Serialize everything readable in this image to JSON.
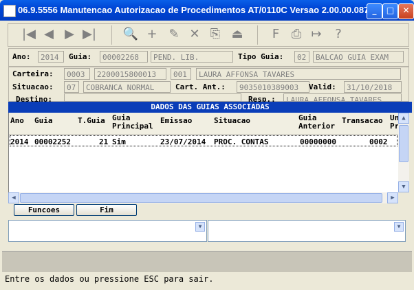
{
  "window": {
    "title": "06.9.5556 Manutencao Autorizacao de Procedimentos AT/0110C Versao 2.00.00.087...",
    "min": "_",
    "max": "□",
    "close": "✕"
  },
  "toolbar": {
    "first": "|◀",
    "prev": "◀",
    "next": "▶",
    "last": "▶|",
    "search": "🔍",
    "add": "+",
    "edit": "✎",
    "delete": "✕",
    "copy": "⎘",
    "exit": "⏏",
    "filter": "F",
    "print": "⎙",
    "close_prog": "↦",
    "help": "?"
  },
  "form": {
    "ano_label": "Ano:",
    "ano_value": "2014",
    "guia_label": "Guia:",
    "guia_value": "00002268",
    "guia_status": "PEND. LIB.",
    "tipo_guia_label": "Tipo Guia:",
    "tipo_guia_code": "02",
    "tipo_guia_desc": "BALCAO GUIA EXAM",
    "carteira_label": "Carteira:",
    "carteira_1": "0003",
    "carteira_2": "2200015800013",
    "carteira_3": "001",
    "carteira_nome": "LAURA AFFONSA TAVARES",
    "situacao_label": "Situacao:",
    "situacao_code": "07",
    "situacao_desc": "COBRANCA NORMAL",
    "cart_ant_label": "Cart. Ant.:",
    "cart_ant_value": "9035010389003",
    "valid_label": "Valid:",
    "valid_value": "31/10/2018",
    "destino_label": "Destino:",
    "resp_label": "Resp.:",
    "resp_value": "LAURA AFFONSA TAVARES"
  },
  "grid": {
    "title": "DADOS DAS GUIAS ASSOCIADAS",
    "columns": [
      {
        "line1": "",
        "line2": "Ano"
      },
      {
        "line1": "",
        "line2": "Guia"
      },
      {
        "line1": "",
        "line2": "T.Guia"
      },
      {
        "line1": "Guia",
        "line2": "Principal"
      },
      {
        "line1": "",
        "line2": "Emissao"
      },
      {
        "line1": "",
        "line2": "Situacao"
      },
      {
        "line1": "Guia",
        "line2": "Anterior"
      },
      {
        "line1": "",
        "line2": "Transacao"
      },
      {
        "line1": "Un",
        "line2": "Pr"
      }
    ],
    "rows": [
      {
        "ano": "2014",
        "guia": "00002252",
        "tguia": "21",
        "principal": "Sim",
        "emissao": "23/07/2014",
        "situacao": "PROC. CONTAS",
        "anterior": "00000000",
        "transacao": "0002"
      }
    ],
    "scroll_up": "▲",
    "scroll_down": "▼",
    "scroll_left": "◀",
    "scroll_right": "▶"
  },
  "buttons": {
    "funcoes": "Funcoes",
    "fim": "Fim"
  },
  "combo_arrow": "▼",
  "status_message": "Entre os dados ou pressione ESC para sair."
}
